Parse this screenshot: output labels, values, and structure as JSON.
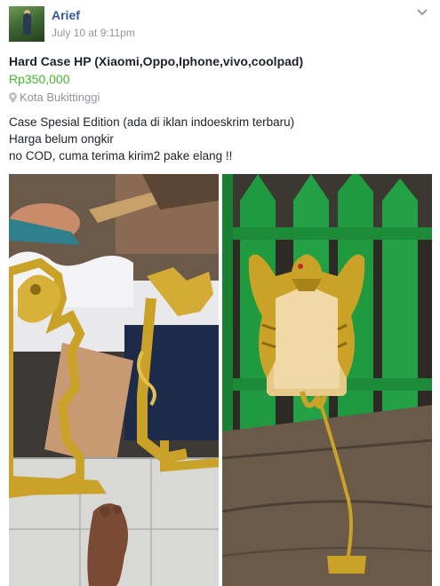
{
  "post": {
    "author": "Arief",
    "timestamp": "July 10 at 9:11pm",
    "title": "Hard Case HP (Xiaomi,Oppo,Iphone,vivo,coolpad)",
    "price": "Rp350,000",
    "location": "Kota Bukittinggi",
    "description_lines": [
      "Case Spesial Edition (ada di iklan indoeskrim terbaru)",
      "Harga belum ongkir",
      "no COD, cuma terima kirim2 pake elang !!"
    ]
  },
  "icons": {
    "menu": "chevron-down-icon",
    "location": "map-pin-icon"
  },
  "colors": {
    "author_link": "#365899",
    "price": "#42b72a",
    "meta": "#90949c",
    "text": "#1d2129",
    "gold": "#c9a227"
  }
}
